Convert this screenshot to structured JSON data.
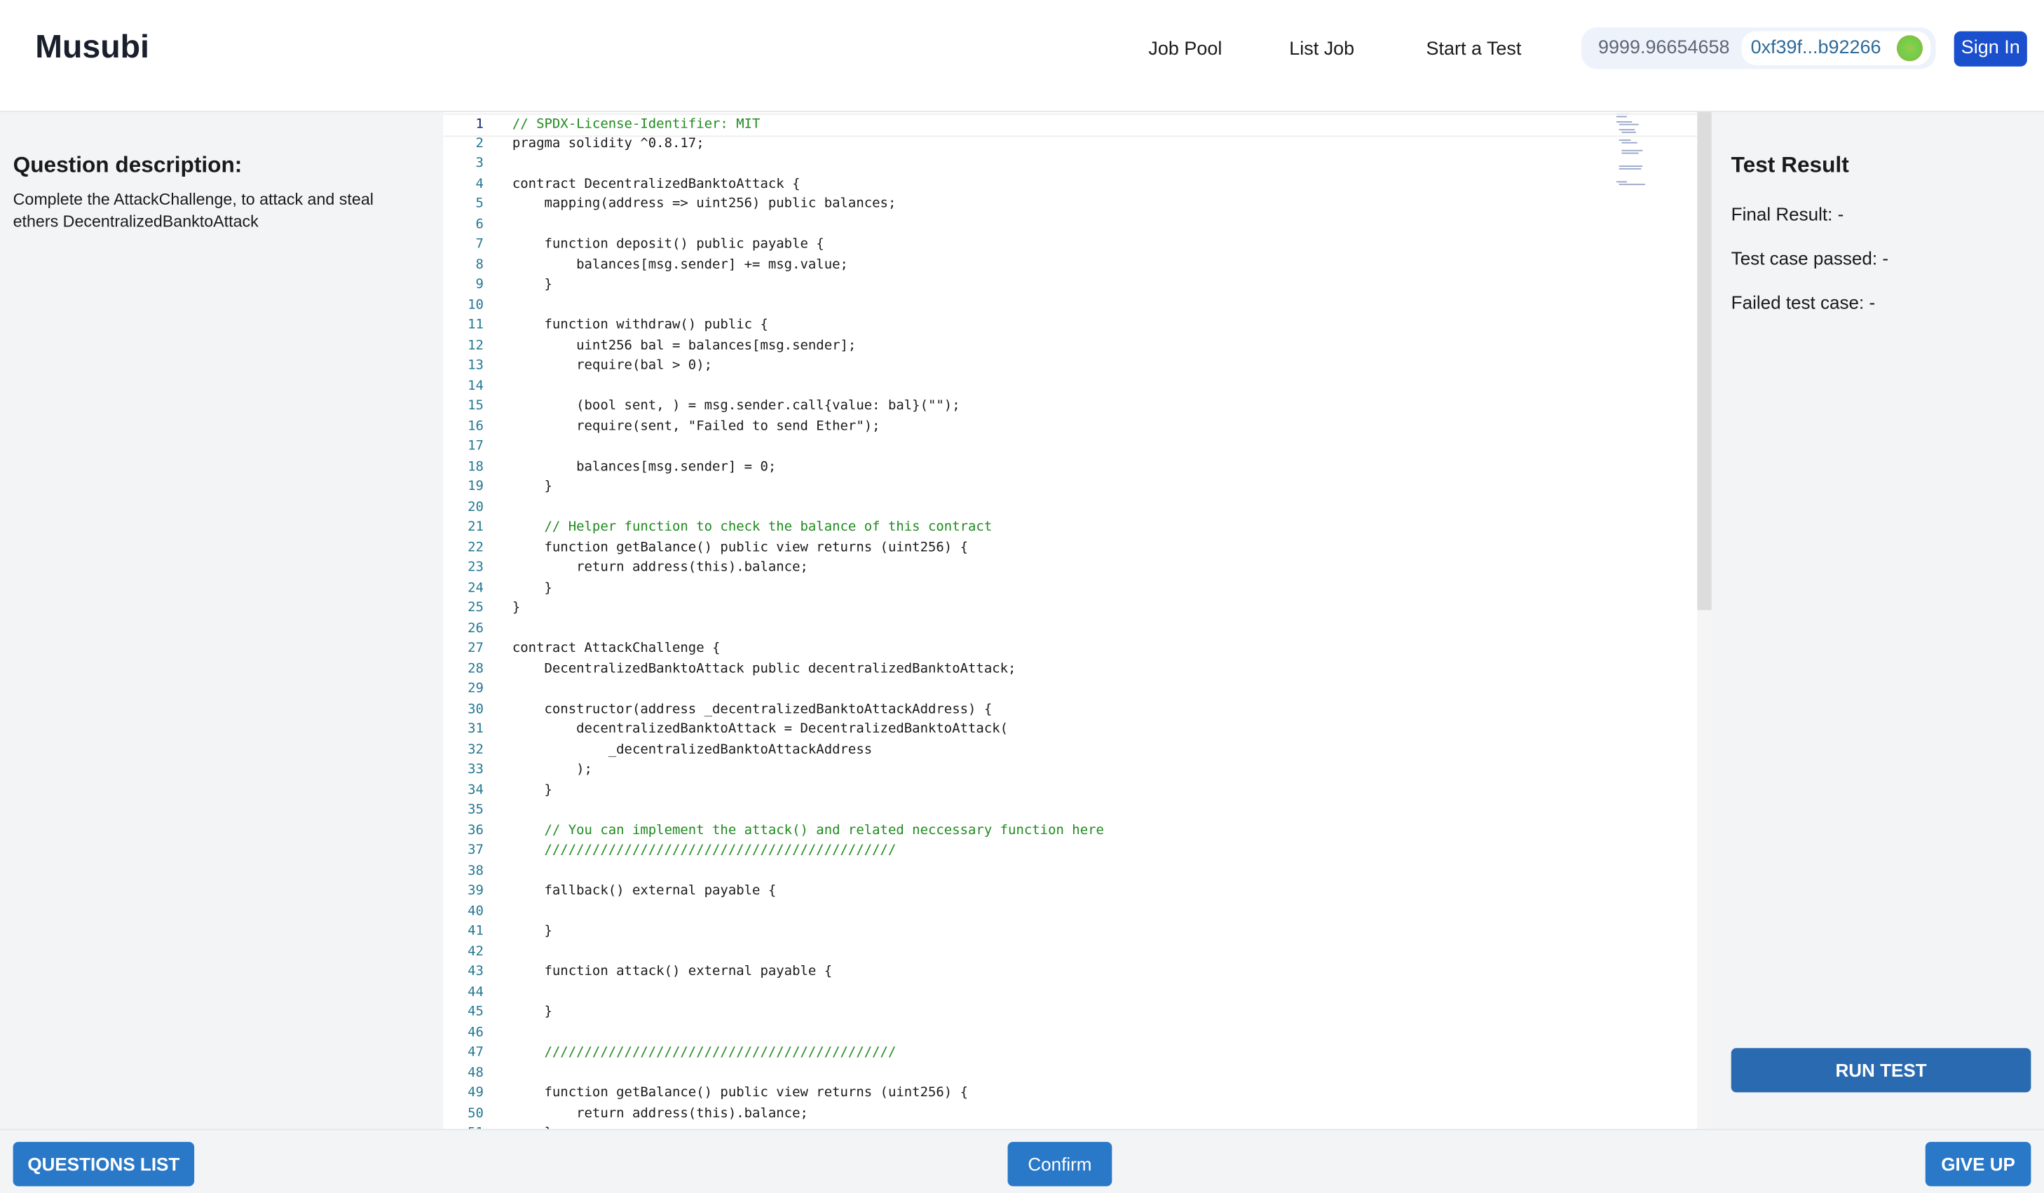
{
  "header": {
    "logo": "Musubi",
    "nav": [
      "Job Pool",
      "List Job",
      "Start a Test"
    ],
    "balance": "9999.96654658",
    "address": "0xf39f...b92266",
    "sign_in": "Sign In"
  },
  "question": {
    "title": "Question description:",
    "text": "Complete the AttackChallenge, to attack and steal ethers DecentralizedBanktoAttack"
  },
  "result": {
    "title": "Test Result",
    "final": "Final Result: -",
    "passed": "Test case passed: -",
    "failed": "Failed test case: -",
    "run": "RUN TEST"
  },
  "footer": {
    "questions": "QUESTIONS LIST",
    "confirm": "Confirm",
    "give_up": "GIVE UP"
  },
  "colors": {
    "accent": "#2a78c8",
    "sign_in": "#1a4fce"
  },
  "code": [
    "// SPDX-License-Identifier: MIT",
    "pragma solidity ^0.8.17;",
    "",
    "contract DecentralizedBanktoAttack {",
    "    mapping(address => uint256) public balances;",
    "",
    "    function deposit() public payable {",
    "        balances[msg.sender] += msg.value;",
    "    }",
    "",
    "    function withdraw() public {",
    "        uint256 bal = balances[msg.sender];",
    "        require(bal > 0);",
    "",
    "        (bool sent, ) = msg.sender.call{value: bal}(\"\");",
    "        require(sent, \"Failed to send Ether\");",
    "",
    "        balances[msg.sender] = 0;",
    "    }",
    "",
    "    // Helper function to check the balance of this contract",
    "    function getBalance() public view returns (uint256) {",
    "        return address(this).balance;",
    "    }",
    "}",
    "",
    "contract AttackChallenge {",
    "    DecentralizedBanktoAttack public decentralizedBanktoAttack;",
    "",
    "    constructor(address _decentralizedBanktoAttackAddress) {",
    "        decentralizedBanktoAttack = DecentralizedBanktoAttack(",
    "            _decentralizedBanktoAttackAddress",
    "        );",
    "    }",
    "",
    "    // You can implement the attack() and related neccessary function here",
    "    ////////////////////////////////////////////",
    "",
    "    fallback() external payable {",
    "",
    "    }",
    "",
    "    function attack() external payable {",
    "",
    "    }",
    "",
    "    ////////////////////////////////////////////",
    "",
    "    function getBalance() public view returns (uint256) {",
    "        return address(this).balance;",
    "    }"
  ]
}
